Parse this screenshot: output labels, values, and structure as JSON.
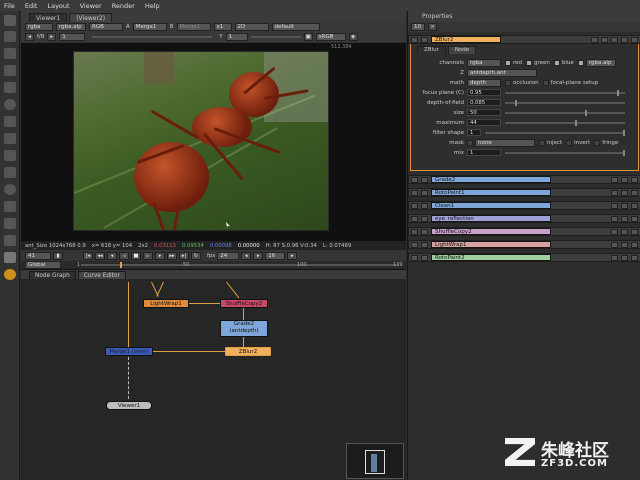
{
  "menubar": [
    "File",
    "Edit",
    "Layout",
    "Viewer",
    "Render",
    "Help"
  ],
  "viewer": {
    "tabs": [
      "Viewer1",
      "(Viewer2)"
    ],
    "row1": {
      "channels": "rgba",
      "alpha": "rgba.alp",
      "rgb": "RGB",
      "a_input": "Merge1",
      "b_label": "B",
      "b_input": "Merge1",
      "zoom": "x1",
      "proxy": "2D",
      "lut": "default"
    },
    "row2": {
      "fstop": "f/8",
      "frame_field": "1",
      "gain_label": "1",
      "y_field": "1",
      "lut2": "sRGB"
    },
    "coord": "512,384",
    "status": {
      "format": "ant_Size 1024x768 0.9",
      "xy": "x= 618 y= 104",
      "proxy": "2x2",
      "r": "0.03113",
      "g": "0.09534",
      "b": "0.00098",
      "a": "0.00000",
      "hsv": "H: 87 S:0.96 V:0.34",
      "l": "L: 0.07489"
    },
    "transport": {
      "frame": "41",
      "fps_label": "fps",
      "fps": "24",
      "range_end": "16"
    },
    "timeline": {
      "scope": "Global",
      "ticks": [
        "1",
        "50",
        "100",
        "139"
      ],
      "start": "1",
      "end": "139"
    }
  },
  "nodegraph": {
    "tabs": [
      "Node Graph",
      "Curve Editor"
    ],
    "nodes": {
      "lightwrap1": "LightWrap1",
      "shufflecopy": "ShuffleCopy2",
      "grade2_a": "Grade2",
      "grade2_b": "(antdepth)",
      "zblur2": "ZBlur2",
      "merge1": "Merge1 (over)",
      "viewer1": "Viewer1"
    },
    "colors": {
      "lightwrap": "#e08a3a",
      "shuffle": "#c8486a",
      "grade": "#7fa6d8",
      "zblur": "#f0b060",
      "merge": "#3a5ab8",
      "viewer": "#bdbdbd",
      "wire": "#e0a040"
    }
  },
  "properties": {
    "title": "Properties",
    "count": "10",
    "panels": [
      {
        "name": "ZBlur2",
        "color": "#f0b060"
      },
      {
        "name": "Grade2",
        "color": "#7fa6d8"
      },
      {
        "name": "RotoPaint1",
        "color": "#7fa6d8"
      },
      {
        "name": "Clean1",
        "color": "#7fa6d8"
      },
      {
        "name": "eye_reflection",
        "color": "#a0a0d8"
      },
      {
        "name": "ShuffleCopy2",
        "color": "#c8a0c8"
      },
      {
        "name": "LightWrap1",
        "color": "#d8a0a0"
      },
      {
        "name": "RotoPaint2",
        "color": "#a0d0a0"
      }
    ],
    "zblur": {
      "tabs": [
        "ZBlur",
        "Node"
      ],
      "channels": {
        "label": "channels",
        "value": "rgba",
        "r": "red",
        "g": "green",
        "b": "blue",
        "alpha": "rgba.alp"
      },
      "z": {
        "label": "Z",
        "value": "antdepth.ant"
      },
      "math": {
        "label": "math",
        "value": "depth",
        "occlusion": "occlusion",
        "focal": "focal-plane setup"
      },
      "focus_plane": {
        "label": "focus plane (C)",
        "value": "0.95"
      },
      "depth_of_field": {
        "label": "depth-of-field",
        "value": "0.085"
      },
      "size": {
        "label": "size",
        "value": "50"
      },
      "maximum": {
        "label": "maximum",
        "value": "44"
      },
      "filter_shape": {
        "label": "filter shape",
        "value": "1"
      },
      "mask": {
        "label": "mask",
        "value": "none",
        "inject": "inject",
        "invert": "invert",
        "fringe": "fringe"
      },
      "mix": {
        "label": "mix",
        "value": "1"
      }
    }
  },
  "watermark": {
    "line1": "朱峰社区",
    "line2": "ZF3D.COM"
  }
}
